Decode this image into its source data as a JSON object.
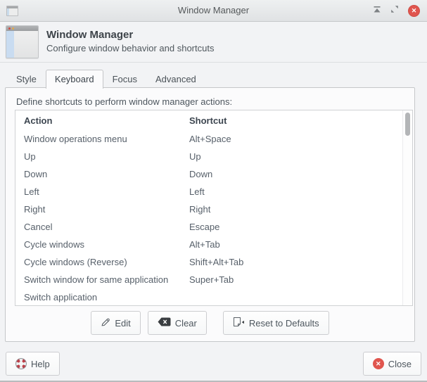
{
  "titlebar": {
    "title": "Window Manager"
  },
  "header": {
    "title": "Window Manager",
    "subtitle": "Configure window behavior and shortcuts"
  },
  "tabs": [
    {
      "label": "Style",
      "active": false
    },
    {
      "label": "Keyboard",
      "active": true
    },
    {
      "label": "Focus",
      "active": false
    },
    {
      "label": "Advanced",
      "active": false
    }
  ],
  "keyboard": {
    "description": "Define shortcuts to perform window manager actions:",
    "columns": {
      "action": "Action",
      "shortcut": "Shortcut"
    },
    "rows": [
      {
        "action": "Window operations menu",
        "shortcut": "Alt+Space"
      },
      {
        "action": "Up",
        "shortcut": "Up"
      },
      {
        "action": "Down",
        "shortcut": "Down"
      },
      {
        "action": "Left",
        "shortcut": "Left"
      },
      {
        "action": "Right",
        "shortcut": "Right"
      },
      {
        "action": "Cancel",
        "shortcut": "Escape"
      },
      {
        "action": "Cycle windows",
        "shortcut": "Alt+Tab"
      },
      {
        "action": "Cycle windows (Reverse)",
        "shortcut": "Shift+Alt+Tab"
      },
      {
        "action": "Switch window for same application",
        "shortcut": "Super+Tab"
      },
      {
        "action": "Switch application",
        "shortcut": ""
      }
    ],
    "buttons": {
      "edit": "Edit",
      "clear": "Clear",
      "reset": "Reset to Defaults"
    }
  },
  "footer": {
    "help": "Help",
    "close": "Close"
  },
  "icons": {
    "titlebar": [
      "window-icon",
      "shade-icon",
      "maximize-icon",
      "close-icon"
    ],
    "buttons": [
      "pencil-icon",
      "backspace-icon",
      "revert-document-icon",
      "lifesaver-help-icon",
      "close-circle-icon"
    ]
  },
  "colors": {
    "close_red": "#e0554e",
    "help_red": "#bc4049",
    "window_bg": "#f2f3f5",
    "frame_bg": "#fbfbfc"
  }
}
